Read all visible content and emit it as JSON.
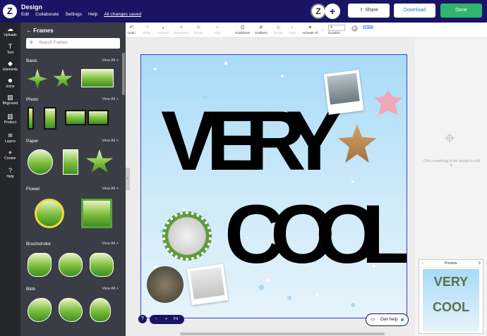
{
  "app": {
    "title": "Design",
    "menu": [
      "Edit",
      "Collaborate",
      "Settings",
      "Help"
    ],
    "saved": "All changes saved",
    "avatar": "Z"
  },
  "header": {
    "share": "Share",
    "download": "Download",
    "done": "Done"
  },
  "nav": [
    {
      "label": "Uploads",
      "icon": "cloud-upload-icon",
      "glyph": "☁"
    },
    {
      "label": "Text",
      "icon": "text-icon",
      "glyph": "T"
    },
    {
      "label": "Elements",
      "icon": "elements-icon",
      "glyph": "◆"
    },
    {
      "label": "Icons",
      "icon": "smiley-icon",
      "glyph": "☻"
    },
    {
      "label": "Bkground",
      "icon": "background-icon",
      "glyph": "▧"
    },
    {
      "label": "Product",
      "icon": "product-icon",
      "glyph": "▥"
    },
    {
      "label": "Layers",
      "icon": "layers-icon",
      "glyph": "≋"
    },
    {
      "label": "Creator",
      "icon": "creator-avatar-icon",
      "glyph": "●"
    },
    {
      "label": "Help",
      "icon": "help-icon",
      "glyph": "?"
    }
  ],
  "panel": {
    "title": "Frames",
    "search_placeholder": "Search Frames",
    "view_all": "View All >",
    "sections": [
      "Basic",
      "Photo",
      "Paper",
      "Flower",
      "Brushstroke",
      "Blob"
    ]
  },
  "toolbar": [
    {
      "label": "Undo",
      "glyph": "↶",
      "enabled": true
    },
    {
      "label": "Redo",
      "glyph": "↷",
      "enabled": false
    },
    {
      "label": "Forward",
      "glyph": "▲",
      "enabled": false
    },
    {
      "label": "Backward",
      "glyph": "▼",
      "enabled": false
    },
    {
      "label": "Group",
      "glyph": "⧉",
      "enabled": false
    },
    {
      "label": "Align",
      "glyph": "≡",
      "enabled": false
    },
    {
      "label": "Guidelines",
      "glyph": "⊡",
      "enabled": true
    },
    {
      "label": "Gridlines",
      "glyph": "#",
      "enabled": true
    },
    {
      "label": "Group",
      "glyph": "⊞",
      "enabled": false
    },
    {
      "label": "Mask",
      "glyph": "◐",
      "enabled": false
    },
    {
      "label": "Animate All",
      "glyph": "✶",
      "enabled": true
    }
  ],
  "duration": {
    "label": "Duration",
    "value": "4"
  },
  "beta": "BETA",
  "canvas": {
    "line1": [
      "V",
      "E",
      "R",
      "Y"
    ],
    "line2": [
      "C",
      "O",
      "O",
      "L"
    ]
  },
  "hint": "Click something in the design to edit it.",
  "preview": {
    "title": "Preview"
  },
  "gethelp": "Get help",
  "zoom": {
    "minus": "−",
    "plus": "+",
    "fit": "Fit"
  },
  "help_q": "?"
}
